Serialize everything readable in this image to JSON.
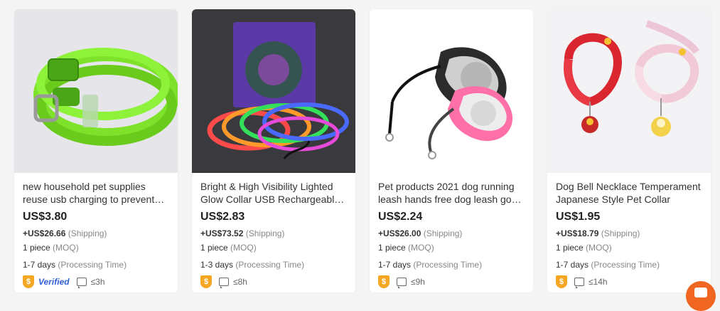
{
  "products": [
    {
      "title": "new household pet supplies reuse usb charging to prevent…",
      "price": "US$3.80",
      "shipping_value": "+US$26.66",
      "shipping_label": "(Shipping)",
      "moq_value": "1 piece",
      "moq_label": "(MOQ)",
      "processing_value": "1-7 days",
      "processing_label": "(Processing Time)",
      "badge_icon": "gold-supplier-icon",
      "verified_label": "Verified",
      "response_time": "≤3h"
    },
    {
      "title": "Bright & High Visibility Lighted Glow Collar USB Rechargeabl…",
      "price": "US$2.83",
      "shipping_value": "+US$73.52",
      "shipping_label": "(Shipping)",
      "moq_value": "1 piece",
      "moq_label": "(MOQ)",
      "processing_value": "1-3 days",
      "processing_label": "(Processing Time)",
      "badge_icon": "gold-supplier-icon",
      "verified_label": "",
      "response_time": "≤8h"
    },
    {
      "title": "Pet products 2021 dog running leash hands free dog leash go…",
      "price": "US$2.24",
      "shipping_value": "+US$26.00",
      "shipping_label": "(Shipping)",
      "moq_value": "1 piece",
      "moq_label": "(MOQ)",
      "processing_value": "1-7 days",
      "processing_label": "(Processing Time)",
      "badge_icon": "gold-supplier-icon",
      "verified_label": "",
      "response_time": "≤9h"
    },
    {
      "title": "Dog Bell Necklace Temperament Japanese Style Pet Collar",
      "price": "US$1.95",
      "shipping_value": "+US$18.79",
      "shipping_label": "(Shipping)",
      "moq_value": "1 piece",
      "moq_label": "(MOQ)",
      "processing_value": "1-7 days",
      "processing_label": "(Processing Time)",
      "badge_icon": "gold-supplier-icon",
      "verified_label": "",
      "response_time": "≤14h"
    }
  ],
  "badge_glyph": "$",
  "colors": {
    "badge": "#f5a623",
    "verified": "#2f5fd8",
    "fab": "#f0651f"
  },
  "fab_icon": "chat-bubble-icon"
}
